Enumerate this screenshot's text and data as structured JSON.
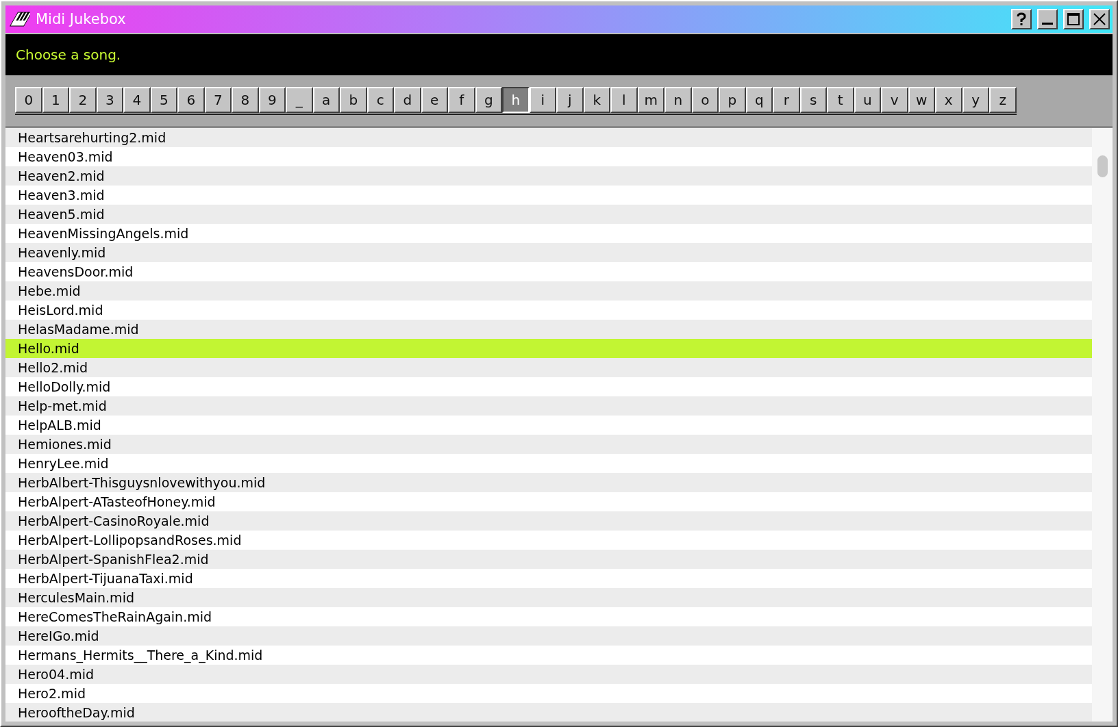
{
  "window": {
    "title": "Midi Jukebox"
  },
  "prompt": "Choose a song.",
  "keys": [
    {
      "label": "0",
      "selected": false
    },
    {
      "label": "1",
      "selected": false
    },
    {
      "label": "2",
      "selected": false
    },
    {
      "label": "3",
      "selected": false
    },
    {
      "label": "4",
      "selected": false
    },
    {
      "label": "5",
      "selected": false
    },
    {
      "label": "6",
      "selected": false
    },
    {
      "label": "7",
      "selected": false
    },
    {
      "label": "8",
      "selected": false
    },
    {
      "label": "9",
      "selected": false
    },
    {
      "label": "_",
      "selected": false
    },
    {
      "label": "a",
      "selected": false
    },
    {
      "label": "b",
      "selected": false
    },
    {
      "label": "c",
      "selected": false
    },
    {
      "label": "d",
      "selected": false
    },
    {
      "label": "e",
      "selected": false
    },
    {
      "label": "f",
      "selected": false
    },
    {
      "label": "g",
      "selected": false
    },
    {
      "label": "h",
      "selected": true
    },
    {
      "label": "i",
      "selected": false
    },
    {
      "label": "j",
      "selected": false
    },
    {
      "label": "k",
      "selected": false
    },
    {
      "label": "l",
      "selected": false
    },
    {
      "label": "m",
      "selected": false
    },
    {
      "label": "n",
      "selected": false
    },
    {
      "label": "o",
      "selected": false
    },
    {
      "label": "p",
      "selected": false
    },
    {
      "label": "q",
      "selected": false
    },
    {
      "label": "r",
      "selected": false
    },
    {
      "label": "s",
      "selected": false
    },
    {
      "label": "t",
      "selected": false
    },
    {
      "label": "u",
      "selected": false
    },
    {
      "label": "v",
      "selected": false
    },
    {
      "label": "w",
      "selected": false
    },
    {
      "label": "x",
      "selected": false
    },
    {
      "label": "y",
      "selected": false
    },
    {
      "label": "z",
      "selected": false
    }
  ],
  "songs": [
    {
      "name": "Heartsarehurting2.mid",
      "selected": false
    },
    {
      "name": "Heaven03.mid",
      "selected": false
    },
    {
      "name": "Heaven2.mid",
      "selected": false
    },
    {
      "name": "Heaven3.mid",
      "selected": false
    },
    {
      "name": "Heaven5.mid",
      "selected": false
    },
    {
      "name": "HeavenMissingAngels.mid",
      "selected": false
    },
    {
      "name": "Heavenly.mid",
      "selected": false
    },
    {
      "name": "HeavensDoor.mid",
      "selected": false
    },
    {
      "name": "Hebe.mid",
      "selected": false
    },
    {
      "name": "HeisLord.mid",
      "selected": false
    },
    {
      "name": "HelasMadame.mid",
      "selected": false
    },
    {
      "name": "Hello.mid",
      "selected": true
    },
    {
      "name": "Hello2.mid",
      "selected": false
    },
    {
      "name": "HelloDolly.mid",
      "selected": false
    },
    {
      "name": "Help-met.mid",
      "selected": false
    },
    {
      "name": "HelpALB.mid",
      "selected": false
    },
    {
      "name": "Hemiones.mid",
      "selected": false
    },
    {
      "name": "HenryLee.mid",
      "selected": false
    },
    {
      "name": "HerbAlbert-Thisguysnlovewithyou.mid",
      "selected": false
    },
    {
      "name": "HerbAlpert-ATasteofHoney.mid",
      "selected": false
    },
    {
      "name": "HerbAlpert-CasinoRoyale.mid",
      "selected": false
    },
    {
      "name": "HerbAlpert-LollipopsandRoses.mid",
      "selected": false
    },
    {
      "name": "HerbAlpert-SpanishFlea2.mid",
      "selected": false
    },
    {
      "name": "HerbAlpert-TijuanaTaxi.mid",
      "selected": false
    },
    {
      "name": "HerculesMain.mid",
      "selected": false
    },
    {
      "name": "HereComesTheRainAgain.mid",
      "selected": false
    },
    {
      "name": "HereIGo.mid",
      "selected": false
    },
    {
      "name": "Hermans_Hermits__There_a_Kind.mid",
      "selected": false
    },
    {
      "name": "Hero04.mid",
      "selected": false
    },
    {
      "name": "Hero2.mid",
      "selected": false
    },
    {
      "name": "HerooftheDay.mid",
      "selected": false
    }
  ]
}
